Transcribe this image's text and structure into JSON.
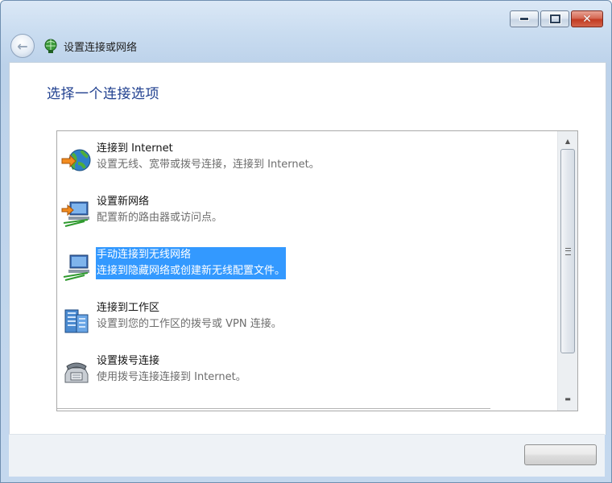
{
  "window": {
    "title": "设置连接或网络",
    "controls": {
      "minimize_icon": "minimize-icon",
      "maximize_icon": "maximize-icon",
      "close_glyph": "✕"
    }
  },
  "nav": {
    "back_icon": "back-arrow-icon",
    "back_glyph": "←",
    "wizard_icon": "network-globe-icon"
  },
  "page": {
    "heading": "选择一个连接选项"
  },
  "options": [
    {
      "title": "连接到 Internet",
      "description": "设置无线、宽带或拨号连接，连接到 Internet。",
      "icon": "internet-globe-icon",
      "selected": false
    },
    {
      "title": "设置新网络",
      "description": "配置新的路由器或访问点。",
      "icon": "new-network-icon",
      "selected": false
    },
    {
      "title": "手动连接到无线网络",
      "description": "连接到隐藏网络或创建新无线配置文件。",
      "icon": "wireless-network-icon",
      "selected": true
    },
    {
      "title": "连接到工作区",
      "description": "设置到您的工作区的拨号或 VPN 连接。",
      "icon": "workplace-building-icon",
      "selected": false
    },
    {
      "title": "设置拨号连接",
      "description": "使用拨号连接连接到 Internet。",
      "icon": "dialup-phone-icon",
      "selected": false
    }
  ],
  "scrollbar": {
    "up_glyph": "▲",
    "down_glyph": "▬"
  },
  "colors": {
    "selection": "#3399ff",
    "heading": "#1f3f8f"
  }
}
